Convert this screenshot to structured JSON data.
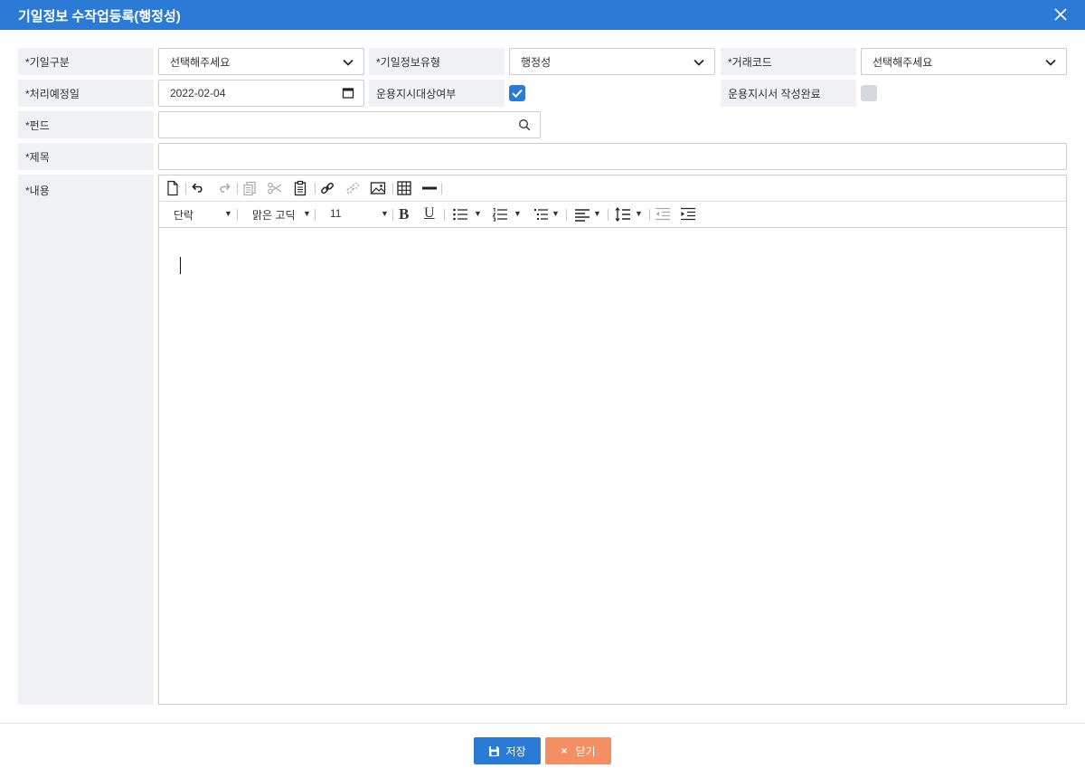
{
  "window": {
    "title": "기일정보 수작업등록(행정성)"
  },
  "form": {
    "category": {
      "label": "*기일구분",
      "value": "선택해주세요"
    },
    "info_type": {
      "label": "*기일정보유형",
      "value": "행정성"
    },
    "trade_code": {
      "label": "*거래코드",
      "value": "선택해주세요"
    },
    "process_date": {
      "label": "*처리예정일",
      "value": "2022-02-04"
    },
    "instruction_target": {
      "label": "운용지시대상여부",
      "checked": true
    },
    "instruction_done": {
      "label": "운용지시서 작성완료",
      "checked": false
    },
    "fund": {
      "label": "*펀드",
      "value": ""
    },
    "subject": {
      "label": "*제목",
      "value": ""
    },
    "content": {
      "label": "*내용"
    }
  },
  "editor": {
    "paragraph": "단락",
    "font": "맑은 고딕",
    "size": "11",
    "bold": "B",
    "underline": "U"
  },
  "footer": {
    "save_label": "저장",
    "close_label": "닫기"
  },
  "colors": {
    "primary": "#2b7ad6",
    "close_button": "#f48f63",
    "label_bg": "#eff1f4"
  }
}
